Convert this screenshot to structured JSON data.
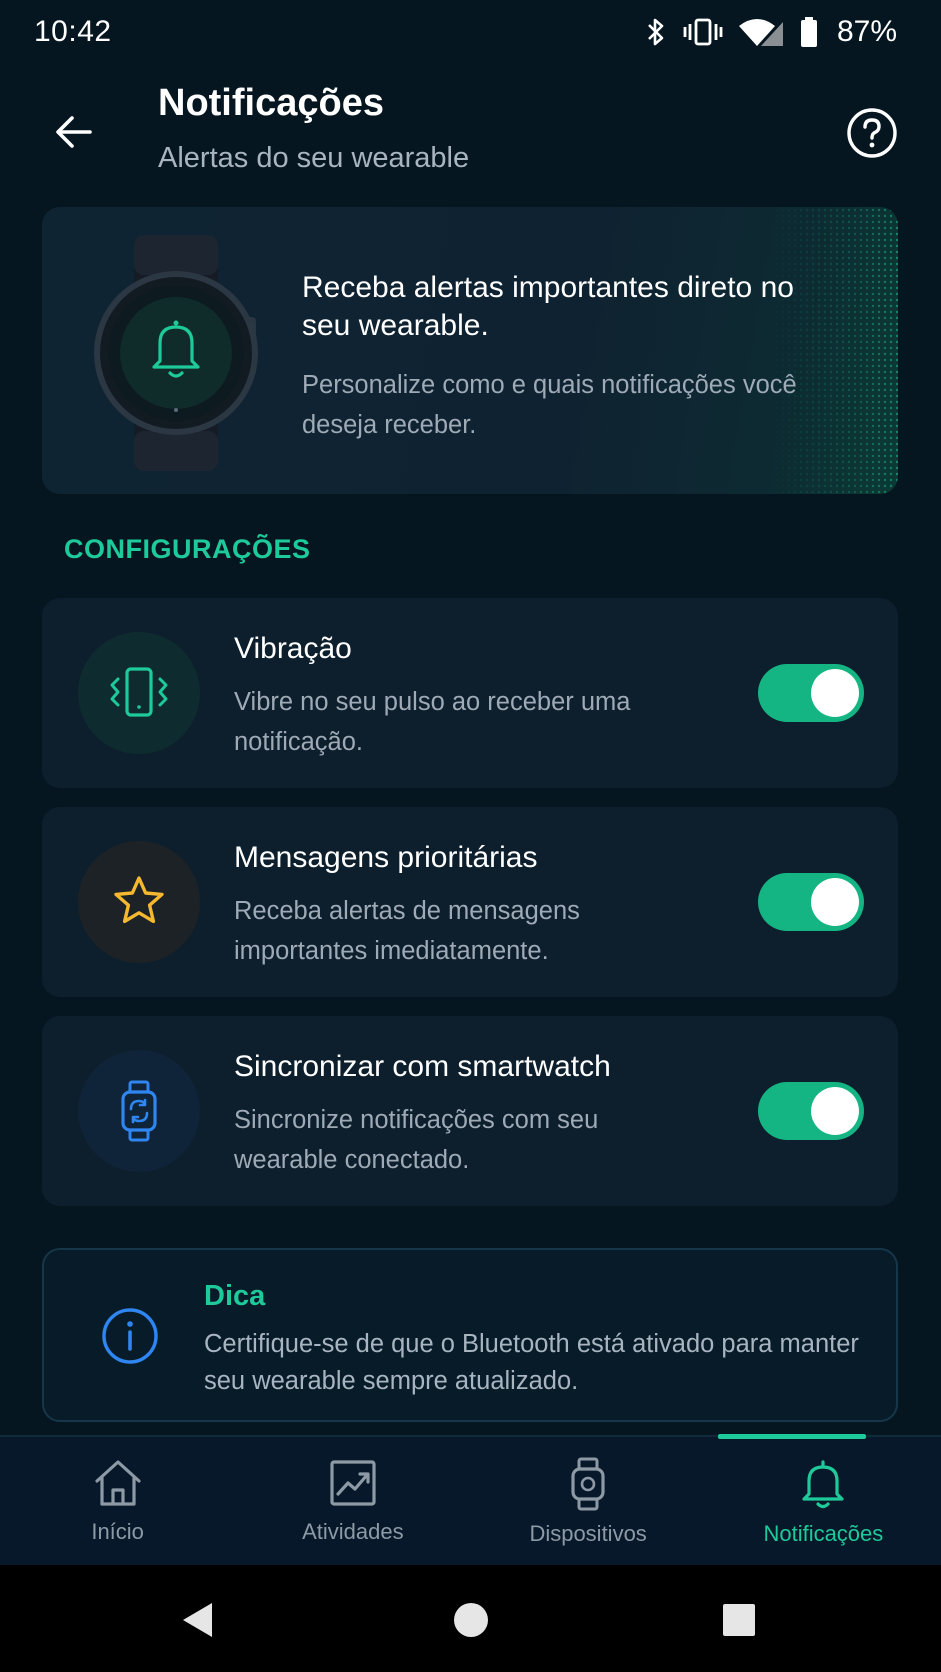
{
  "status_bar": {
    "time": "10:42",
    "battery": "87%"
  },
  "header": {
    "title": "Notificações",
    "subtitle": "Alertas do seu wearable"
  },
  "hero": {
    "title": "Receba alertas importantes direto no seu wearable.",
    "text": "Personalize como e quais notificações você deseja receber."
  },
  "section": {
    "label": "CONFIGURAÇÕES"
  },
  "settings": [
    {
      "title": "Vibração",
      "description": "Vibre no seu pulso ao receber uma notificação.",
      "enabled": true,
      "icon": "vibration-icon",
      "accent": "#1ec99a"
    },
    {
      "title": "Mensagens prioritárias",
      "description": "Receba alertas de mensagens importantes imediatamente.",
      "enabled": true,
      "icon": "star-icon",
      "accent": "#f5b82e"
    },
    {
      "title": "Sincronizar com smartwatch",
      "description": "Sincronize notificações com seu wearable conectado.",
      "enabled": true,
      "icon": "watch-sync-icon",
      "accent": "#2f86f0"
    }
  ],
  "tip": {
    "title": "Dica",
    "text": "Certifique-se de que o Bluetooth está ativado para manter seu wearable sempre atualizado."
  },
  "nav": {
    "items": [
      {
        "label": "Início",
        "icon": "home-icon"
      },
      {
        "label": "Atividades",
        "icon": "activity-chart-icon"
      },
      {
        "label": "Dispositivos",
        "icon": "watch-icon"
      },
      {
        "label": "Notificações",
        "icon": "bell-icon",
        "active": true
      }
    ]
  },
  "colors": {
    "accent": "#1ec99a",
    "background": "#061621",
    "card": "#0d1f2c"
  }
}
